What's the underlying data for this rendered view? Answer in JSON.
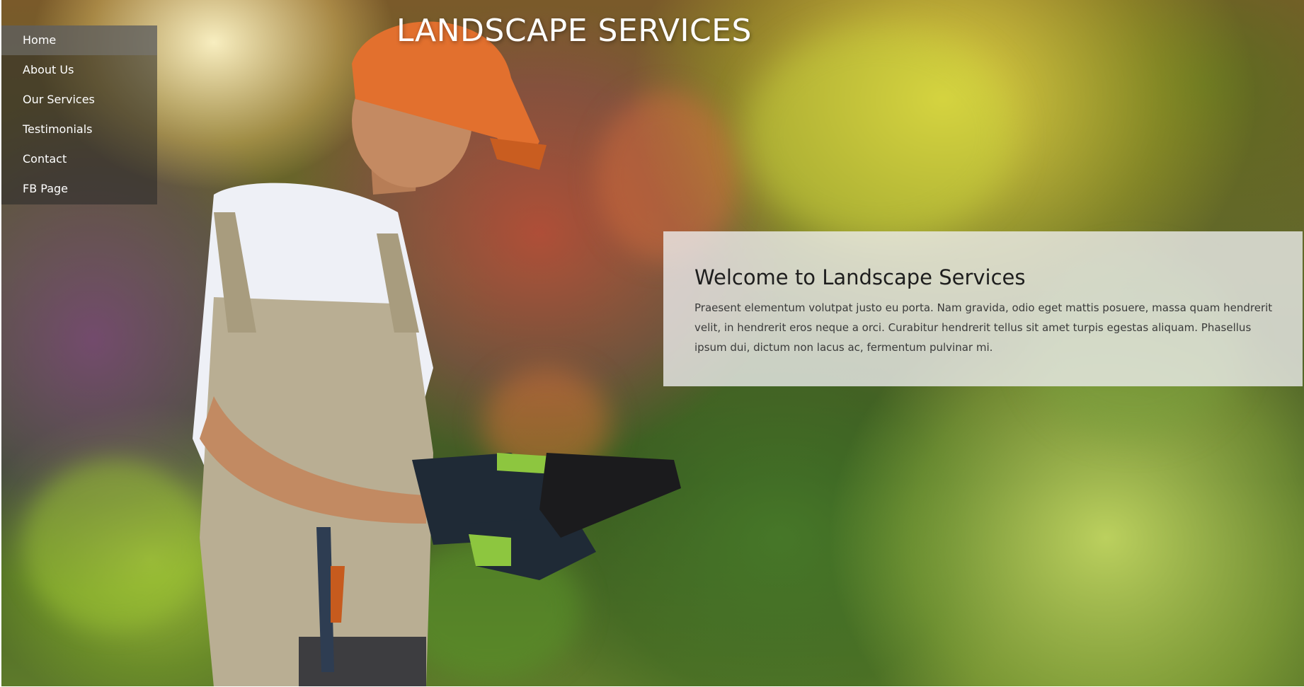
{
  "nav": {
    "items": [
      {
        "label": "Home",
        "active": true
      },
      {
        "label": "About Us",
        "active": false
      },
      {
        "label": "Our Services",
        "active": false
      },
      {
        "label": "Testimonials",
        "active": false
      },
      {
        "label": "Contact",
        "active": false
      },
      {
        "label": "FB Page",
        "active": false
      }
    ]
  },
  "hero": {
    "title": "LANDSCAPE SERVICES",
    "image": "landscaper-with-tablet-photo"
  },
  "welcome": {
    "heading": "Welcome to Landscape Services",
    "body": "Praesent elementum volutpat justo eu porta. Nam gravida, odio eget mattis posuere, massa quam hendrerit velit, in hendrerit eros neque a orci. Curabitur hendrerit tellus sit amet turpis egestas aliquam. Phasellus ipsum dui, dictum non lacus ac, fermentum pulvinar mi."
  },
  "colors": {
    "nav_background": "#282828",
    "nav_active": "#787878",
    "card_background": "#ececec",
    "title_text": "#ffffff"
  }
}
